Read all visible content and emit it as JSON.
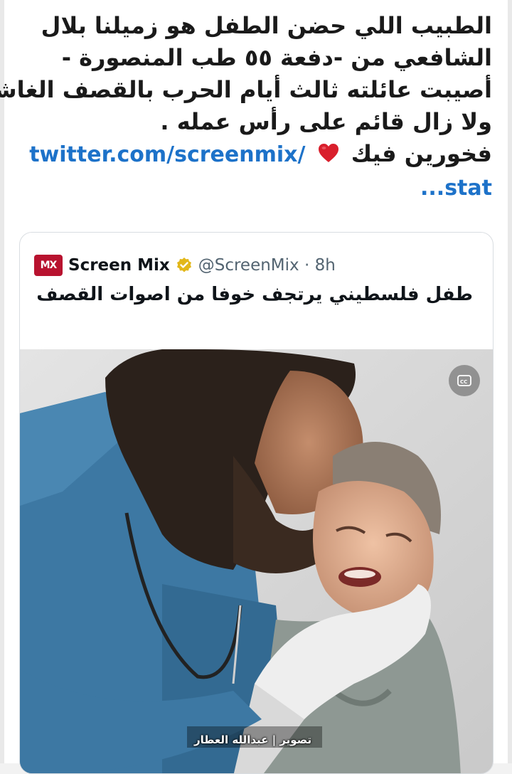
{
  "post": {
    "lines": [
      "الطبيب اللي حضن الطفل هو زميلنا بلال",
      "الشافعي من -دفعة ٥٥ طب المنصورة -",
      "أصيبت عائلته ثالث أيام الحرب بالقصف الغاشم",
      "ولا زال قائم على رأس عمله ."
    ],
    "proud_text": "فخورين فيك",
    "link_text": "twitter.com/screenmix/",
    "link_tail": "...stat",
    "heart_icon": "red-heart-icon"
  },
  "quoted_tweet": {
    "logo_text": "MX",
    "display_name": "Screen Mix",
    "handle_time": "@ScreenMix · 8h",
    "text": "طفل فلسطيني يرتجف خوفا من اصوات القصف",
    "media_caption": "تصوير | عبدالله العطار",
    "icons": [
      "verified-badge-icon",
      "closed-caption-icon"
    ]
  },
  "colors": {
    "link": "#1d72c9",
    "logo": "#b8122f",
    "verified": "#e2b719",
    "scrubs": "#3d78a3"
  }
}
